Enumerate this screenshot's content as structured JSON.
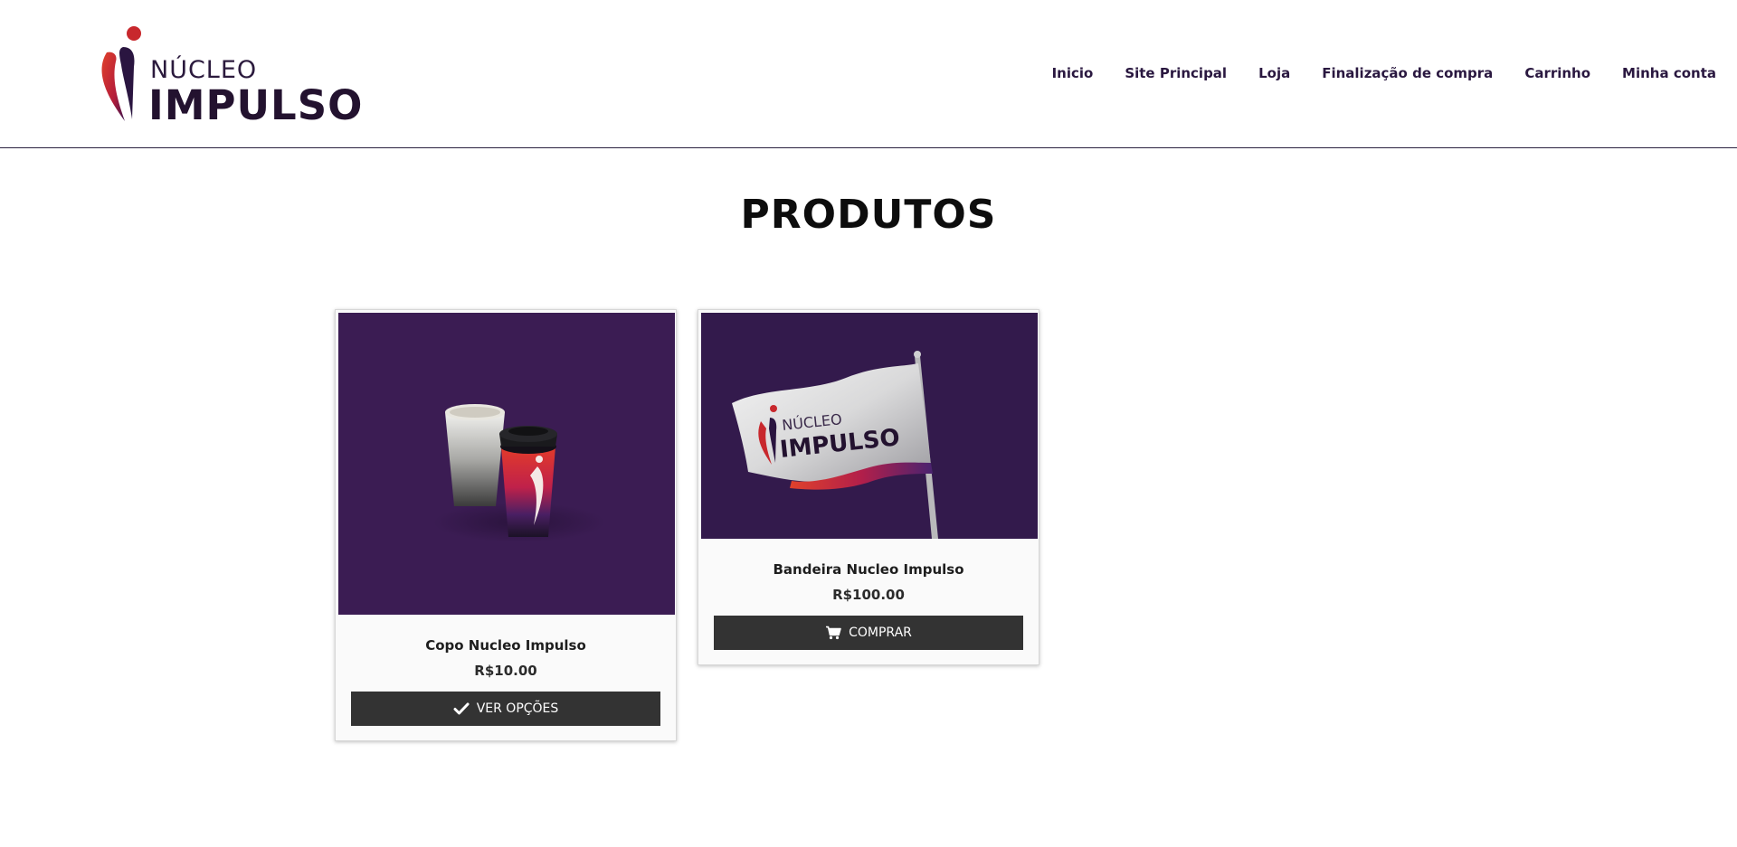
{
  "brand": {
    "logo_top": "NÚCLEO",
    "logo_bottom": "IMPULSO",
    "colors": {
      "mark_red": "#c8282d",
      "mark_dark": "#2a1540",
      "text_dark": "#23122f"
    }
  },
  "nav": {
    "items": [
      {
        "label": "Inicio",
        "name": "nav-inicio"
      },
      {
        "label": "Site Principal",
        "name": "nav-site-principal"
      },
      {
        "label": "Loja",
        "name": "nav-loja"
      },
      {
        "label": "Finalização de compra",
        "name": "nav-finalizacao"
      },
      {
        "label": "Carrinho",
        "name": "nav-carrinho"
      },
      {
        "label": "Minha conta",
        "name": "nav-minha-conta"
      }
    ]
  },
  "main": {
    "title": "PRODUTOS",
    "products": [
      {
        "name": "Copo Nucleo Impulso",
        "price": "R$10.00",
        "button_label": "VER OPÇÕES",
        "button_icon": "check-icon",
        "image": "cups-image"
      },
      {
        "name": "Bandeira Nucleo Impulso",
        "price": "R$100.00",
        "button_label": "COMPRAR",
        "button_icon": "cart-icon",
        "image": "flag-image",
        "flag_logo_top": "NÚCLEO",
        "flag_logo_bottom": "IMPULSO"
      }
    ]
  },
  "colors": {
    "product_bg": "#3b1c53",
    "button_bg": "#333333",
    "header_border": "#2a2140"
  }
}
